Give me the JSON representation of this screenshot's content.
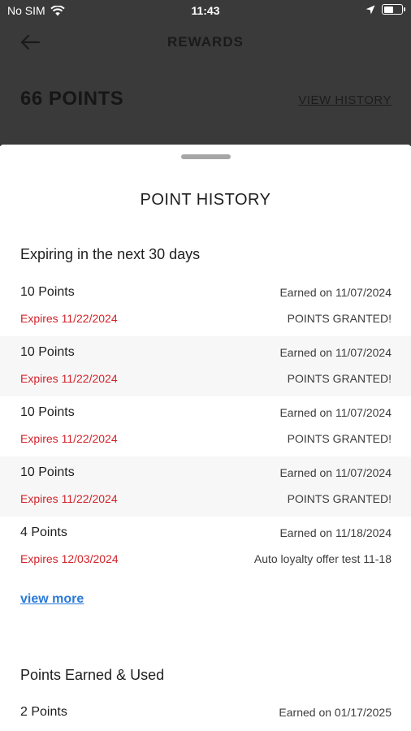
{
  "status_bar": {
    "carrier": "No SIM",
    "time": "11:43",
    "wifi_icon": "wifi-icon",
    "location_icon": "location-arrow-icon",
    "battery_icon": "battery-icon",
    "battery_level": 0.55
  },
  "header": {
    "back_icon": "arrow-left-icon",
    "title": "REWARDS",
    "points_total": "66 POINTS",
    "view_history": "VIEW HISTORY"
  },
  "sheet": {
    "title": "POINT HISTORY",
    "expiring_section": {
      "title": "Expiring in the next 30 days",
      "entries": [
        {
          "points": "10 Points",
          "earned": "Earned on 11/07/2024",
          "expires": "Expires 11/22/2024",
          "reason": "POINTS GRANTED!"
        },
        {
          "points": "10 Points",
          "earned": "Earned on 11/07/2024",
          "expires": "Expires 11/22/2024",
          "reason": "POINTS GRANTED!"
        },
        {
          "points": "10 Points",
          "earned": "Earned on 11/07/2024",
          "expires": "Expires 11/22/2024",
          "reason": "POINTS GRANTED!"
        },
        {
          "points": "10 Points",
          "earned": "Earned on 11/07/2024",
          "expires": "Expires 11/22/2024",
          "reason": "POINTS GRANTED!"
        },
        {
          "points": "4 Points",
          "earned": "Earned on 11/18/2024",
          "expires": "Expires 12/03/2024",
          "reason": "Auto loyalty offer test 11-18"
        }
      ],
      "view_more": "view more"
    },
    "earned_used_section": {
      "title": "Points Earned & Used",
      "entries": [
        {
          "points": "2 Points",
          "earned": "Earned on 01/17/2025"
        }
      ]
    }
  },
  "colors": {
    "expires_red": "#d2232a",
    "link_blue": "#2a7ad8",
    "backdrop": "#3a3a3a"
  }
}
